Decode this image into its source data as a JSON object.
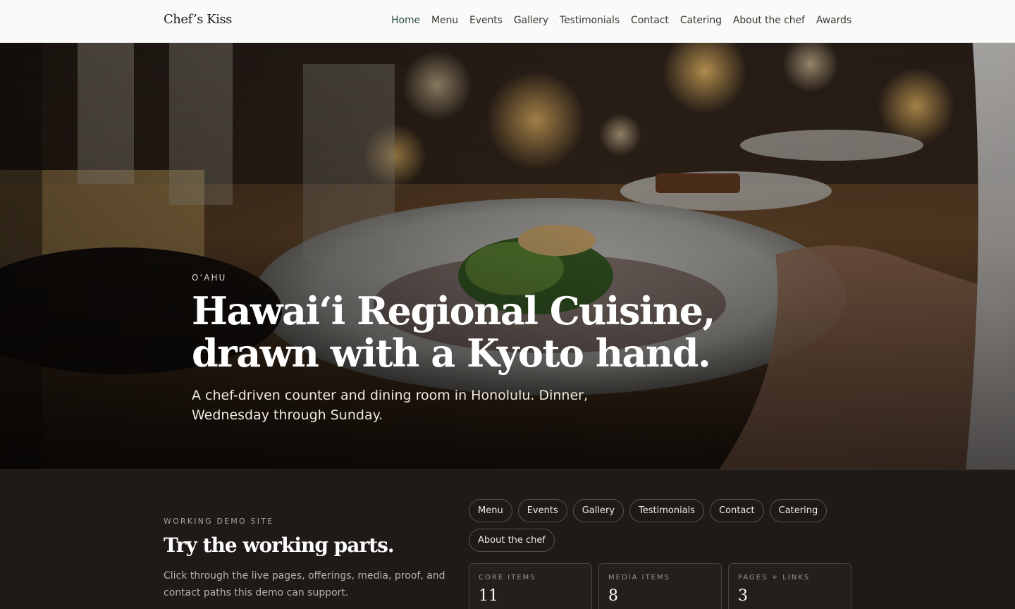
{
  "brand": "Chef’s Kiss",
  "nav": [
    {
      "label": "Home",
      "active": true
    },
    {
      "label": "Menu"
    },
    {
      "label": "Events"
    },
    {
      "label": "Gallery"
    },
    {
      "label": "Testimonials"
    },
    {
      "label": "Contact"
    },
    {
      "label": "Catering"
    },
    {
      "label": "About the chef"
    },
    {
      "label": "Awards"
    }
  ],
  "hero": {
    "eyebrow": "O‘AHU",
    "title": "Hawai‘i Regional Cuisine, drawn with a Kyoto hand.",
    "subtitle": "A chef-driven counter and dining room in Honolulu. Dinner, Wednesday through Sunday."
  },
  "demo": {
    "eyebrow": "WORKING DEMO SITE",
    "title": "Try the working parts.",
    "description": "Click through the live pages, offerings, media, proof, and contact paths this demo can support.",
    "chips": [
      "Menu",
      "Events",
      "Gallery",
      "Testimonials",
      "Contact",
      "Catering",
      "About the chef"
    ],
    "stats": [
      {
        "label": "CORE ITEMS",
        "value": "11"
      },
      {
        "label": "MEDIA ITEMS",
        "value": "8"
      },
      {
        "label": "PAGES + LINKS",
        "value": "3"
      }
    ]
  },
  "colors": {
    "nav_active": "#2f4f40",
    "page_dark": "#1f1a17",
    "topbar_bg": "#fafaf8"
  }
}
